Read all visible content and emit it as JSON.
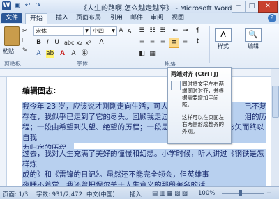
{
  "window": {
    "title": "《人生的路啊,怎么越走越窄》 - Microsoft Word",
    "controls": {
      "minimize": "─",
      "maximize": "□",
      "close": "✕"
    }
  },
  "quick_access": {
    "app_icon": "W",
    "save_icon": "save-icon",
    "undo_icon": "undo-icon",
    "redo_icon": "redo-icon"
  },
  "tabs": [
    {
      "label": "文件"
    },
    {
      "label": "开始"
    },
    {
      "label": "插入"
    },
    {
      "label": "页面布局"
    },
    {
      "label": "引用"
    },
    {
      "label": "邮件"
    },
    {
      "label": "审阅"
    },
    {
      "label": "视图"
    }
  ],
  "ribbon": {
    "paste_label": "粘贴",
    "clipboard_label": "剪贴板",
    "font_name": "宋体",
    "font_size": "小四",
    "font_group_label": "字体",
    "paragraph_label": "段落",
    "styles_label": "样式",
    "edit_label": "编辑",
    "styles_icon": "A",
    "edit_icon": "🔍"
  },
  "tooltip": {
    "title": "两端对齐 (Ctrl+J)",
    "body1": "同时将文字左右两端同时对齐，并根据需要增加字间距。",
    "body2": "这样可以在页面左右两侧形成整齐的外观。"
  },
  "document": {
    "heading": "编辑固志:",
    "para1_line1": "我今年 23 岁，应该说才刚刚走向生活，可人生的",
    "para1_line1_end": "已不复",
    "para1_line2": "存在，我似乎已走到了它的尽头。回顾我走过来的",
    "para1_line2_end": "泪的历",
    "para1_line3": "程；一段由希望到失望、绝望的历程；一段思想长河起于无私的念矢而终以自我",
    "para1_line4": "为归宿的历程。",
    "para2_line1": "过去，我对人生充满了美好的憧憬和幻想。小学时候，听人讲过《钢铁是怎样炼",
    "para2_line2": "成的》和《雷锋的日记》。虽然还不能完全领会，但英雄事",
    "para2_line3": "夜睡不着觉，我还曾把保尔关于人生意义的那段著名的话"
  },
  "status": {
    "page": "页面: 1/3",
    "words": "字数: 931/2,472",
    "language": "中文(中国)",
    "mode": "插入",
    "zoom": "100%"
  }
}
